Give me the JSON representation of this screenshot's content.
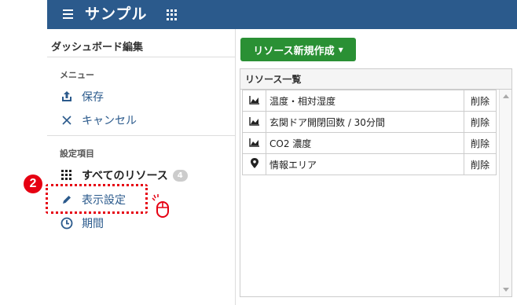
{
  "header": {
    "title": "サンプル",
    "menu_icon": "hamburger-icon",
    "apps_icon": "grid-icon",
    "background_color": "#2b5a8c"
  },
  "sidebar": {
    "title": "ダッシュボード編集",
    "menu_section_label": "メニュー",
    "menu_items": [
      {
        "label": "保存",
        "icon": "upload-icon"
      },
      {
        "label": "キャンセル",
        "icon": "close-icon"
      }
    ],
    "settings_section_label": "設定項目",
    "settings_items": [
      {
        "label": "すべてのリソース",
        "icon": "grid-icon",
        "badge": "4"
      },
      {
        "label": "表示設定",
        "icon": "pencil-icon"
      },
      {
        "label": "期間",
        "icon": "clock-icon"
      }
    ]
  },
  "annotation": {
    "step_number": "2",
    "color": "#e60012"
  },
  "main": {
    "new_resource_button": "リソース新規作成",
    "button_color": "#2a9034",
    "list_title": "リソース一覧",
    "delete_color": "#c9302c",
    "resources": [
      {
        "icon": "area-chart-icon",
        "name": "温度・相対湿度",
        "delete": "削除"
      },
      {
        "icon": "area-chart-icon",
        "name": "玄関ドア開閉回数 / 30分間",
        "delete": "削除"
      },
      {
        "icon": "area-chart-icon",
        "name": "CO2 濃度",
        "delete": "削除"
      },
      {
        "icon": "map-marker-icon",
        "name": "情報エリア",
        "delete": "削除"
      }
    ]
  }
}
